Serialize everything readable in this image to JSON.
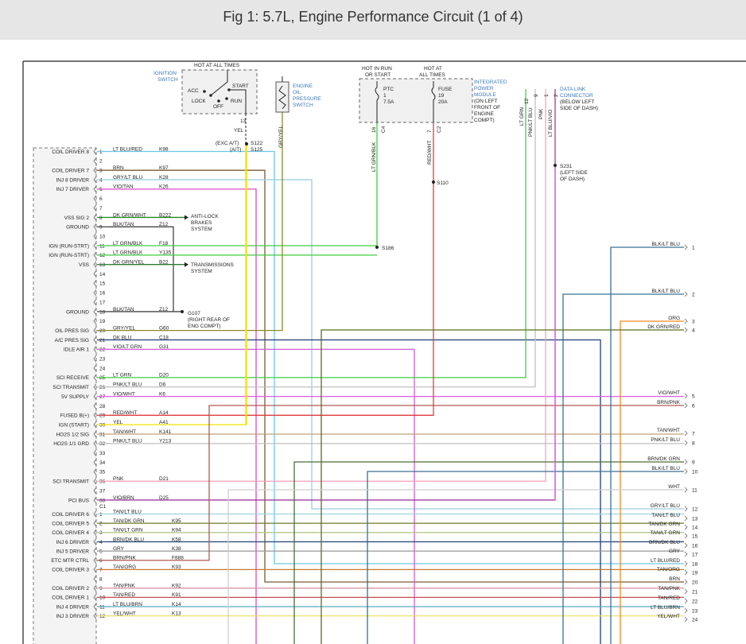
{
  "title": "Fig 1: 5.7L, Engine Performance Circuit (1 of 4)",
  "colors": {
    "ltblu_red": "#6cc6e4",
    "brn": "#7a5a32",
    "gry_ltblu": "#9ccfe0",
    "vio_tan": "#d94cc8",
    "dkgrn_wht": "#228b22",
    "blk_tan": "#444444",
    "ltgrn": "#3fce3f",
    "dkgrn_yel": "#2e7d32",
    "gry_yel": "#8a8a2a",
    "dkblu": "#1f3a7a",
    "vio_ltgrn": "#cf5cd6",
    "pnk_ltblu": "#c0c0c0",
    "vio_wht": "#e25ce2",
    "red_wht": "#e03c3c",
    "yel": "#f4e200",
    "tan_wht": "#c2a27a",
    "pnk": "#f4a0b8",
    "vio_brn": "#a03ca0",
    "tan_ltblu": "#9ed2e0",
    "tan_dkgrn": "#6b7d2a",
    "tan_ltgrn": "#b2c88c",
    "brn_dkblu": "#2f4e7c",
    "gry": "#999999",
    "brn_pnk": "#b05a50",
    "tan_org": "#c47a2a",
    "tan_pnk": "#d89aa0",
    "tan_red": "#c45050",
    "ltblu_brn": "#5aa6c0",
    "yel_wht": "#e8e070",
    "blk_ltblu": "#3a7090",
    "org": "#f08a20",
    "dkgrn_red": "#5a6e1e",
    "brn_dkgrn": "#4a6e3a",
    "wht": "#cfcfcf",
    "black": "#222222",
    "label": "#3b78b8"
  },
  "ignition_switch": {
    "label_1": "IGNITION",
    "label_2": "SWITCH",
    "hot": "HOT AT ALL TIMES",
    "acc": "ACC",
    "lock": "LOCK",
    "off": "OFF",
    "start": "START",
    "run": "RUN",
    "pin": "13",
    "wire": "YEL",
    "note_1": "(EXC A/T)",
    "note_2": "(A/T)",
    "splice_1": "S122",
    "splice_2": "S125"
  },
  "oil_switch": {
    "label_1": "ENGINE",
    "label_2": "OIL",
    "label_3": "PRESSURE",
    "label_4": "SWITCH",
    "wire": "GRY/YEL"
  },
  "ipm": {
    "hot_1a": "HOT IN RUN",
    "hot_1b": "OR START",
    "hot_2a": "HOT AT",
    "hot_2b": "ALL TIMES",
    "ptc_1": "PTC",
    "ptc_2": "1",
    "ptc_3": "7.5A",
    "fuse_1": "FUSE",
    "fuse_2": "19",
    "fuse_3": "20A",
    "label_1": "INTEGRATED",
    "label_2": "POWER",
    "label_3": "MODULE",
    "label_4": "(ON LEFT",
    "label_5": "FRONT OF",
    "label_6": "ENGINE",
    "label_7": "COMPT)",
    "pin_a": "16",
    "conn_a": "C4",
    "pin_b": "7",
    "conn_b": "C2",
    "wire_a": "LT GRN/BLK",
    "wire_b": "RED/WHT",
    "splice_a": "S186",
    "splice_b": "S110"
  },
  "dlc": {
    "label_1": "DATA LINK",
    "label_2": "CONNECTOR",
    "label_3": "(BELOW LEFT",
    "label_4": "SIDE OF DASH)",
    "pins": [
      "12",
      "9",
      "1",
      "2"
    ],
    "wires": [
      "LT GRN",
      "PNK/LT BLU",
      "PNK",
      "LT BLU/VIO"
    ],
    "splice": "S231",
    "splice_note_1": "(LEFT SIDE",
    "splice_note_2": "OF DASH)"
  },
  "pcm_rows": [
    {
      "pin": "1",
      "desc": "COIL DRIVER 8",
      "wire": "LT BLU/RED",
      "circuit": "K98"
    },
    {
      "pin": "2",
      "desc": "",
      "wire": "",
      "circuit": ""
    },
    {
      "pin": "3",
      "desc": "COIL DRIVER 7",
      "wire": "BRN",
      "circuit": "K97"
    },
    {
      "pin": "4",
      "desc": "INJ 8 DRIVER",
      "wire": "GRY/LT BLU",
      "circuit": "K28"
    },
    {
      "pin": "5",
      "desc": "INJ 7 DRIVER",
      "wire": "VIO/TAN",
      "circuit": "K26"
    },
    {
      "pin": "6",
      "desc": "",
      "wire": "",
      "circuit": ""
    },
    {
      "pin": "7",
      "desc": "",
      "wire": "",
      "circuit": ""
    },
    {
      "pin": "8",
      "desc": "VSS SIG 2",
      "wire": "DK GRN/WHT",
      "circuit": "B222"
    },
    {
      "pin": "9",
      "desc": "GROUND",
      "wire": "BLK/TAN",
      "circuit": "Z12"
    },
    {
      "pin": "10",
      "desc": "",
      "wire": "",
      "circuit": ""
    },
    {
      "pin": "11",
      "desc": "IGN (RUN-STRT)",
      "wire": "LT GRN/BLK",
      "circuit": "F18"
    },
    {
      "pin": "12",
      "desc": "IGN (RUN-STRT)",
      "wire": "LT GRN/BLK",
      "circuit": "Y135"
    },
    {
      "pin": "13",
      "desc": "VSS",
      "wire": "DK GRN/YEL",
      "circuit": "B22"
    },
    {
      "pin": "14",
      "desc": "",
      "wire": "",
      "circuit": ""
    },
    {
      "pin": "15",
      "desc": "",
      "wire": "",
      "circuit": ""
    },
    {
      "pin": "16",
      "desc": "",
      "wire": "",
      "circuit": ""
    },
    {
      "pin": "17",
      "desc": "",
      "wire": "",
      "circuit": ""
    },
    {
      "pin": "18",
      "desc": "GROUND",
      "wire": "BLK/TAN",
      "circuit": "Z12"
    },
    {
      "pin": "19",
      "desc": "",
      "wire": "",
      "circuit": ""
    },
    {
      "pin": "20",
      "desc": "OIL PRES SIG",
      "wire": "GRY/YEL",
      "circuit": "G60"
    },
    {
      "pin": "21",
      "desc": "A/C PRES SIG",
      "wire": "DK BLU",
      "circuit": "C18"
    },
    {
      "pin": "22",
      "desc": "IDLE AIR 1",
      "wire": "VIO/LT GRN",
      "circuit": "G31"
    },
    {
      "pin": "23",
      "desc": "",
      "wire": "",
      "circuit": ""
    },
    {
      "pin": "24",
      "desc": "",
      "wire": "",
      "circuit": ""
    },
    {
      "pin": "25",
      "desc": "SCI RECEIVE",
      "wire": "LT GRN",
      "circuit": "D20"
    },
    {
      "pin": "26",
      "desc": "SCI TRANSMIT",
      "wire": "PNK/LT BLU",
      "circuit": "D6"
    },
    {
      "pin": "27",
      "desc": "5V SUPPLY",
      "wire": "VIO/WHT",
      "circuit": "K6"
    },
    {
      "pin": "28",
      "desc": "",
      "wire": "",
      "circuit": ""
    },
    {
      "pin": "29",
      "desc": "FUSED B(+)",
      "wire": "RED/WHT",
      "circuit": "A14"
    },
    {
      "pin": "30",
      "desc": "IGN (START)",
      "wire": "YEL",
      "circuit": "A41"
    },
    {
      "pin": "31",
      "desc": "HO2S 1/2 SIG",
      "wire": "TAN/WHT",
      "circuit": "K141"
    },
    {
      "pin": "32",
      "desc": "HO2S 1/1 GRD",
      "wire": "PNK/LT BLU",
      "circuit": "Y213"
    },
    {
      "pin": "33",
      "desc": "",
      "wire": "",
      "circuit": ""
    },
    {
      "pin": "34",
      "desc": "",
      "wire": "",
      "circuit": ""
    },
    {
      "pin": "35",
      "desc": "",
      "wire": "",
      "circuit": ""
    },
    {
      "pin": "36",
      "desc": "SCI TRANSMIT",
      "wire": "PNK",
      "circuit": "D21"
    },
    {
      "pin": "37",
      "desc": "",
      "wire": "",
      "circuit": ""
    },
    {
      "pin": "38",
      "desc": "PCI BUS",
      "wire": "VIO/BRN",
      "circuit": "D25"
    }
  ],
  "c1_label": "C1",
  "c1_rows": [
    {
      "pin": "1",
      "desc": "COIL DRIVER 6",
      "wire": "TAN/LT BLU",
      "circuit": ""
    },
    {
      "pin": "2",
      "desc": "COIL DRIVER 5",
      "wire": "TAN/DK GRN",
      "circuit": "K95"
    },
    {
      "pin": "3",
      "desc": "COIL DRIVER 4",
      "wire": "TAN/LT GRN",
      "circuit": "K94"
    },
    {
      "pin": "4",
      "desc": "INJ 6 DRIVER",
      "wire": "BRN/DK BLU",
      "circuit": "K58"
    },
    {
      "pin": "5",
      "desc": "INJ 5 DRIVER",
      "wire": "GRY",
      "circuit": "K38"
    },
    {
      "pin": "6",
      "desc": "ETC MTR CTRL",
      "wire": "BRN/PNK",
      "circuit": "F888"
    },
    {
      "pin": "7",
      "desc": "COIL DRIVER 3",
      "wire": "TAN/ORG",
      "circuit": "K93"
    },
    {
      "pin": "8",
      "desc": "",
      "wire": "",
      "circuit": ""
    },
    {
      "pin": "9",
      "desc": "COIL DRIVER 2",
      "wire": "TAN/PNK",
      "circuit": "K92"
    },
    {
      "pin": "10",
      "desc": "COIL DRIVER 1",
      "wire": "TAN/RED",
      "circuit": "K91"
    },
    {
      "pin": "11",
      "desc": "INJ 4 DRIVER",
      "wire": "LT BLU/BRN",
      "circuit": "K14"
    },
    {
      "pin": "12",
      "desc": "INJ 3 DRIVER",
      "wire": "YEL/WHT",
      "circuit": "K13"
    }
  ],
  "right_rows": [
    {
      "num": "1",
      "wire": "BLK/LT BLU"
    },
    {
      "num": "2",
      "wire": "BLK/LT BLU"
    },
    {
      "num": "3",
      "wire": "ORG"
    },
    {
      "num": "4",
      "wire": "DK GRN/RED"
    },
    {
      "num": "5",
      "wire": "VIO/WHT"
    },
    {
      "num": "6",
      "wire": "BRN/PNK"
    },
    {
      "num": "7",
      "wire": "TAN/WHT"
    },
    {
      "num": "8",
      "wire": "PNK/LT BLU"
    },
    {
      "num": "9",
      "wire": "BRN/DK GRN"
    },
    {
      "num": "10",
      "wire": "BLK/LT BLU"
    },
    {
      "num": "11",
      "wire": "WHT"
    },
    {
      "num": "12",
      "wire": "GRY/LT BLU"
    },
    {
      "num": "13",
      "wire": "TAN/LT BLU"
    },
    {
      "num": "14",
      "wire": "TAN/DK GRN"
    },
    {
      "num": "15",
      "wire": "TAN/LT GRN"
    },
    {
      "num": "16",
      "wire": "BRN/DK BLU"
    },
    {
      "num": "17",
      "wire": "GRY"
    },
    {
      "num": "18",
      "wire": "LT BLU/RED"
    },
    {
      "num": "19",
      "wire": "TAN/ORG"
    },
    {
      "num": "20",
      "wire": "BRN"
    },
    {
      "num": "21",
      "wire": "TAN/PNK"
    },
    {
      "num": "22",
      "wire": "TAN/RED"
    },
    {
      "num": "23",
      "wire": "LT BLU/BRN"
    },
    {
      "num": "24",
      "wire": "YEL/WHT"
    }
  ],
  "anti_lock": {
    "l1": "ANTI-LOCK",
    "l2": "BRAKES",
    "l3": "SYSTEM"
  },
  "transmission": {
    "l1": "TRANSMISSIONS",
    "l2": "SYSTEM"
  },
  "ground": {
    "id": "G107",
    "n1": "(RIGHT REAR OF",
    "n2": "ENG COMPT)"
  }
}
